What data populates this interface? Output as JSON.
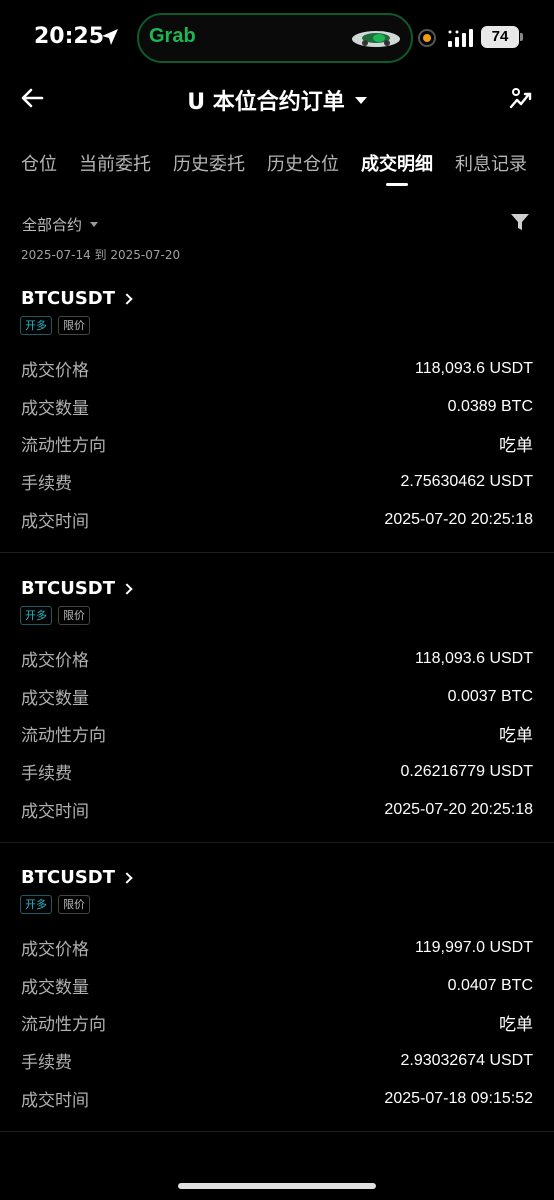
{
  "status_bar": {
    "time": "20:25",
    "island_app": "Grab",
    "battery": "74"
  },
  "header": {
    "title": "U 本位合约订单"
  },
  "tabs": [
    {
      "label": "仓位",
      "active": false
    },
    {
      "label": "当前委托",
      "active": false
    },
    {
      "label": "历史委托",
      "active": false
    },
    {
      "label": "历史仓位",
      "active": false
    },
    {
      "label": "成交明细",
      "active": true
    },
    {
      "label": "利息记录",
      "active": false
    }
  ],
  "filter": {
    "contract": "全部合约",
    "date_range": "2025-07-14 到 2025-07-20"
  },
  "labels": {
    "price": "成交价格",
    "qty": "成交数量",
    "liquidity": "流动性方向",
    "fee": "手续费",
    "time": "成交时间"
  },
  "trades": [
    {
      "symbol": "BTCUSDT",
      "side_badge": "开多",
      "type_badge": "限价",
      "price": "118,093.6 USDT",
      "qty": "0.0389 BTC",
      "liquidity": "吃单",
      "fee": "2.75630462 USDT",
      "time": "2025-07-20 20:25:18"
    },
    {
      "symbol": "BTCUSDT",
      "side_badge": "开多",
      "type_badge": "限价",
      "price": "118,093.6 USDT",
      "qty": "0.0037 BTC",
      "liquidity": "吃单",
      "fee": "0.26216779 USDT",
      "time": "2025-07-20 20:25:18"
    },
    {
      "symbol": "BTCUSDT",
      "side_badge": "开多",
      "type_badge": "限价",
      "price": "119,997.0 USDT",
      "qty": "0.0407 BTC",
      "liquidity": "吃单",
      "fee": "2.93032674 USDT",
      "time": "2025-07-18 09:15:52"
    }
  ],
  "colors": {
    "background": "#000000",
    "accent_long": "#2ab7c9",
    "grab_green": "#1fb552"
  }
}
